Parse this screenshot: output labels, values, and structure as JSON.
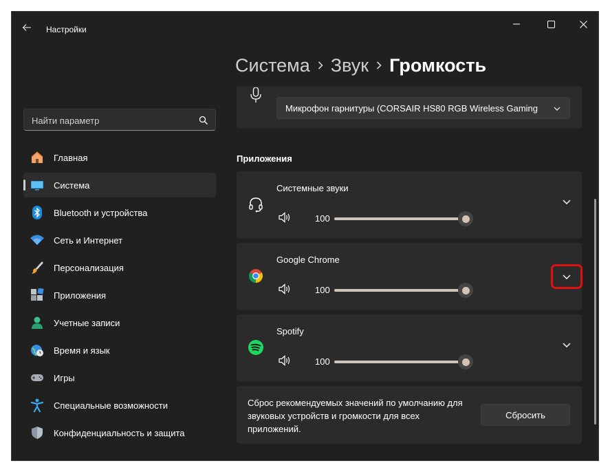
{
  "window": {
    "title": "Настройки"
  },
  "breadcrumb": {
    "level1": "Система",
    "level2": "Звук",
    "current": "Громкость"
  },
  "search": {
    "placeholder": "Найти параметр"
  },
  "sidebar": {
    "items": [
      {
        "label": "Главная",
        "icon": "home-icon"
      },
      {
        "label": "Система",
        "icon": "system-icon",
        "active": true
      },
      {
        "label": "Bluetooth и устройства",
        "icon": "bluetooth-icon"
      },
      {
        "label": "Сеть и Интернет",
        "icon": "wifi-icon"
      },
      {
        "label": "Персонализация",
        "icon": "brush-icon"
      },
      {
        "label": "Приложения",
        "icon": "apps-icon"
      },
      {
        "label": "Учетные записи",
        "icon": "person-icon"
      },
      {
        "label": "Время и язык",
        "icon": "globe-clock-icon"
      },
      {
        "label": "Игры",
        "icon": "gamepad-icon"
      },
      {
        "label": "Специальные возможности",
        "icon": "accessibility-icon"
      },
      {
        "label": "Конфиденциальность и защита",
        "icon": "shield-icon"
      }
    ]
  },
  "microphone": {
    "selected": "Микрофон гарнитуры (CORSAIR HS80 RGB Wireless Gaming"
  },
  "apps_section": {
    "title": "Приложения",
    "apps": [
      {
        "name": "Системные звуки",
        "volume": 100,
        "icon": "headset-icon"
      },
      {
        "name": "Google Chrome",
        "volume": 100,
        "icon": "chrome-icon"
      },
      {
        "name": "Spotify",
        "volume": 100,
        "icon": "spotify-icon"
      }
    ]
  },
  "reset": {
    "text": "Сброс рекомендуемых значений по умолчанию для звуковых устройств и громкости для всех приложений.",
    "button": "Сбросить"
  },
  "colors": {
    "accent_slider": "#d1c3b8",
    "highlight": "#e01010",
    "background": "#202020",
    "card": "#2b2b2b"
  }
}
